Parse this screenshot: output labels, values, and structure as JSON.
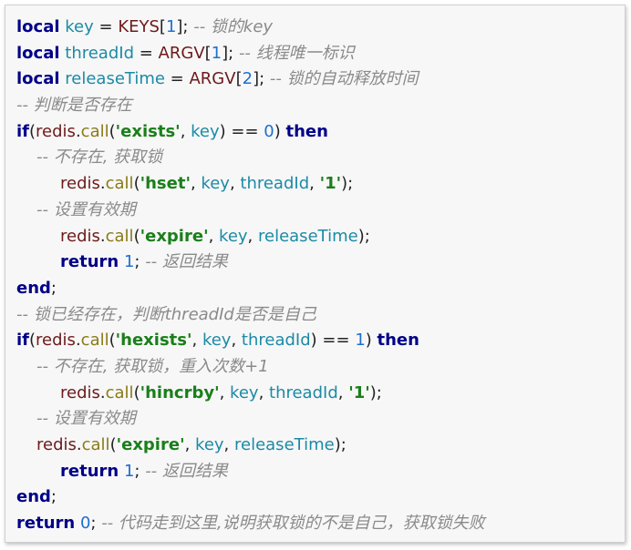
{
  "code": {
    "lines": [
      {
        "tokens": [
          {
            "t": "local",
            "c": "kw"
          },
          {
            "t": " ",
            "c": "op"
          },
          {
            "t": "key",
            "c": "id"
          },
          {
            "t": " = ",
            "c": "op"
          },
          {
            "t": "KEYS",
            "c": "glob"
          },
          {
            "t": "[",
            "c": "op"
          },
          {
            "t": "1",
            "c": "num"
          },
          {
            "t": "]; ",
            "c": "op"
          },
          {
            "t": "-- 锁的key",
            "c": "cmt"
          }
        ]
      },
      {
        "tokens": [
          {
            "t": "local",
            "c": "kw"
          },
          {
            "t": " ",
            "c": "op"
          },
          {
            "t": "threadId",
            "c": "id"
          },
          {
            "t": " = ",
            "c": "op"
          },
          {
            "t": "ARGV",
            "c": "glob"
          },
          {
            "t": "[",
            "c": "op"
          },
          {
            "t": "1",
            "c": "num"
          },
          {
            "t": "]; ",
            "c": "op"
          },
          {
            "t": "-- 线程唯一标识",
            "c": "cmt"
          }
        ]
      },
      {
        "tokens": [
          {
            "t": "local",
            "c": "kw"
          },
          {
            "t": " ",
            "c": "op"
          },
          {
            "t": "releaseTime",
            "c": "id"
          },
          {
            "t": " = ",
            "c": "op"
          },
          {
            "t": "ARGV",
            "c": "glob"
          },
          {
            "t": "[",
            "c": "op"
          },
          {
            "t": "2",
            "c": "num"
          },
          {
            "t": "]; ",
            "c": "op"
          },
          {
            "t": "-- 锁的自动释放时间",
            "c": "cmt"
          }
        ]
      },
      {
        "tokens": [
          {
            "t": "-- 判断是否存在",
            "c": "cmt"
          }
        ]
      },
      {
        "tokens": [
          {
            "t": "if",
            "c": "kw"
          },
          {
            "t": "(",
            "c": "op"
          },
          {
            "t": "redis",
            "c": "glob"
          },
          {
            "t": ".",
            "c": "op"
          },
          {
            "t": "call",
            "c": "fn"
          },
          {
            "t": "(",
            "c": "op"
          },
          {
            "t": "'exists'",
            "c": "str"
          },
          {
            "t": ", ",
            "c": "op"
          },
          {
            "t": "key",
            "c": "id"
          },
          {
            "t": ") == ",
            "c": "op"
          },
          {
            "t": "0",
            "c": "num"
          },
          {
            "t": ") ",
            "c": "op"
          },
          {
            "t": "then",
            "c": "kw"
          }
        ]
      },
      {
        "indent": 1,
        "tokens": [
          {
            "t": "-- 不存在, 获取锁",
            "c": "cmt"
          }
        ]
      },
      {
        "indent": 2,
        "tokens": [
          {
            "t": "redis",
            "c": "glob"
          },
          {
            "t": ".",
            "c": "op"
          },
          {
            "t": "call",
            "c": "fn"
          },
          {
            "t": "(",
            "c": "op"
          },
          {
            "t": "'hset'",
            "c": "str"
          },
          {
            "t": ", ",
            "c": "op"
          },
          {
            "t": "key",
            "c": "id"
          },
          {
            "t": ", ",
            "c": "op"
          },
          {
            "t": "threadId",
            "c": "id"
          },
          {
            "t": ", ",
            "c": "op"
          },
          {
            "t": "'1'",
            "c": "str"
          },
          {
            "t": ");",
            "c": "op"
          }
        ]
      },
      {
        "indent": 1,
        "tokens": [
          {
            "t": "-- 设置有效期",
            "c": "cmt"
          }
        ]
      },
      {
        "indent": 2,
        "tokens": [
          {
            "t": "redis",
            "c": "glob"
          },
          {
            "t": ".",
            "c": "op"
          },
          {
            "t": "call",
            "c": "fn"
          },
          {
            "t": "(",
            "c": "op"
          },
          {
            "t": "'expire'",
            "c": "str"
          },
          {
            "t": ", ",
            "c": "op"
          },
          {
            "t": "key",
            "c": "id"
          },
          {
            "t": ", ",
            "c": "op"
          },
          {
            "t": "releaseTime",
            "c": "id"
          },
          {
            "t": ");",
            "c": "op"
          }
        ]
      },
      {
        "indent": 2,
        "tokens": [
          {
            "t": "return",
            "c": "kw"
          },
          {
            "t": " ",
            "c": "op"
          },
          {
            "t": "1",
            "c": "num"
          },
          {
            "t": "; ",
            "c": "op"
          },
          {
            "t": "-- 返回结果",
            "c": "cmt"
          }
        ]
      },
      {
        "tokens": [
          {
            "t": "end",
            "c": "kw"
          },
          {
            "t": ";",
            "c": "op"
          }
        ]
      },
      {
        "tokens": [
          {
            "t": "-- 锁已经存在，判断threadId是否是自己",
            "c": "cmt"
          }
        ]
      },
      {
        "tokens": [
          {
            "t": "if",
            "c": "kw"
          },
          {
            "t": "(",
            "c": "op"
          },
          {
            "t": "redis",
            "c": "glob"
          },
          {
            "t": ".",
            "c": "op"
          },
          {
            "t": "call",
            "c": "fn"
          },
          {
            "t": "(",
            "c": "op"
          },
          {
            "t": "'hexists'",
            "c": "str"
          },
          {
            "t": ", ",
            "c": "op"
          },
          {
            "t": "key",
            "c": "id"
          },
          {
            "t": ", ",
            "c": "op"
          },
          {
            "t": "threadId",
            "c": "id"
          },
          {
            "t": ") == ",
            "c": "op"
          },
          {
            "t": "1",
            "c": "num"
          },
          {
            "t": ") ",
            "c": "op"
          },
          {
            "t": "then",
            "c": "kw"
          }
        ]
      },
      {
        "indent": 1,
        "tokens": [
          {
            "t": "-- 不存在, 获取锁，重入次数+1",
            "c": "cmt"
          }
        ]
      },
      {
        "indent": 2,
        "tokens": [
          {
            "t": "redis",
            "c": "glob"
          },
          {
            "t": ".",
            "c": "op"
          },
          {
            "t": "call",
            "c": "fn"
          },
          {
            "t": "(",
            "c": "op"
          },
          {
            "t": "'hincrby'",
            "c": "str"
          },
          {
            "t": ", ",
            "c": "op"
          },
          {
            "t": "key",
            "c": "id"
          },
          {
            "t": ", ",
            "c": "op"
          },
          {
            "t": "threadId",
            "c": "id"
          },
          {
            "t": ", ",
            "c": "op"
          },
          {
            "t": "'1'",
            "c": "str"
          },
          {
            "t": ");",
            "c": "op"
          }
        ]
      },
      {
        "indent": 1,
        "tokens": [
          {
            "t": "-- 设置有效期",
            "c": "cmt"
          }
        ]
      },
      {
        "indent": 1,
        "tokens": [
          {
            "t": "redis",
            "c": "glob"
          },
          {
            "t": ".",
            "c": "op"
          },
          {
            "t": "call",
            "c": "fn"
          },
          {
            "t": "(",
            "c": "op"
          },
          {
            "t": "'expire'",
            "c": "str"
          },
          {
            "t": ", ",
            "c": "op"
          },
          {
            "t": "key",
            "c": "id"
          },
          {
            "t": ", ",
            "c": "op"
          },
          {
            "t": "releaseTime",
            "c": "id"
          },
          {
            "t": ");",
            "c": "op"
          }
        ]
      },
      {
        "indent": 2,
        "tokens": [
          {
            "t": "return",
            "c": "kw"
          },
          {
            "t": " ",
            "c": "op"
          },
          {
            "t": "1",
            "c": "num"
          },
          {
            "t": "; ",
            "c": "op"
          },
          {
            "t": "-- 返回结果",
            "c": "cmt"
          }
        ]
      },
      {
        "tokens": [
          {
            "t": "end",
            "c": "kw"
          },
          {
            "t": ";",
            "c": "op"
          }
        ]
      },
      {
        "tokens": [
          {
            "t": "return",
            "c": "kw"
          },
          {
            "t": " ",
            "c": "op"
          },
          {
            "t": "0",
            "c": "num"
          },
          {
            "t": "; ",
            "c": "op"
          },
          {
            "t": "-- 代码走到这里,说明获取锁的不是自己，获取锁失败",
            "c": "cmt"
          }
        ]
      }
    ]
  }
}
